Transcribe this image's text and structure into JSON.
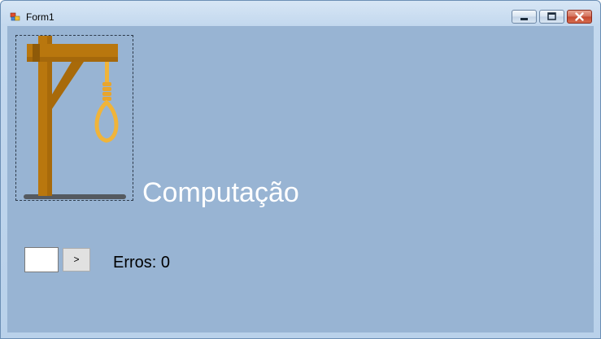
{
  "window": {
    "title": "Form1",
    "icons": {
      "app": "form-app-icon",
      "minimize": "minimize-icon",
      "maximize": "maximize-icon",
      "close": "close-icon"
    },
    "colors": {
      "client_background": "#98b4d3",
      "close_button": "#c4472e"
    }
  },
  "game": {
    "image": "gallows-noose-image",
    "word": "Computação",
    "letter_input": {
      "value": "",
      "placeholder": ""
    },
    "submit_label": ">",
    "errors_label": "Erros:",
    "errors_count": "0",
    "colors": {
      "wood": "#b9770e",
      "rope": "#f0b43a",
      "base": "#555a60",
      "word_text": "#ffffff"
    }
  }
}
